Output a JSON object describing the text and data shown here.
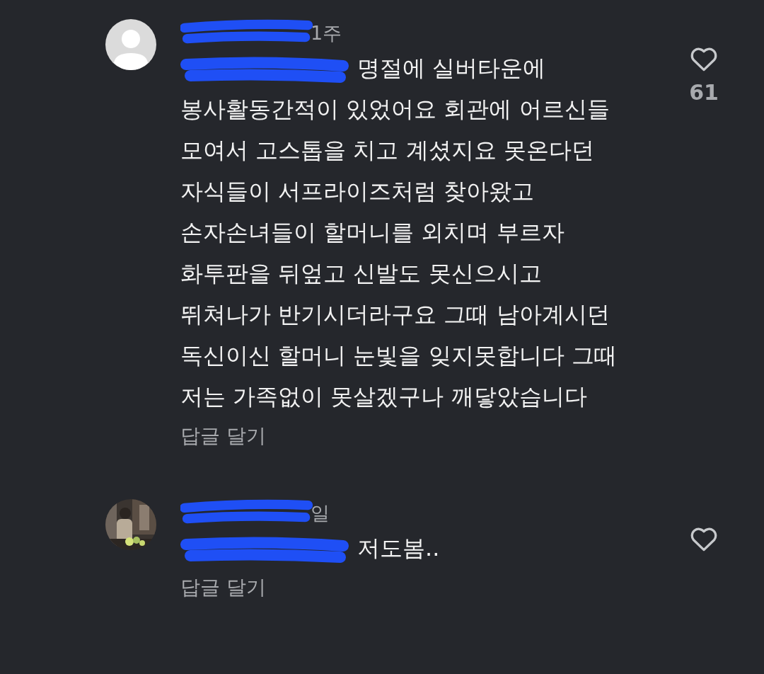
{
  "comments": [
    {
      "kind": "default",
      "time": "1주",
      "lines": [
        "명절에 실버타운에",
        "봉사활동간적이 있었어요 회관에 어르신들",
        "모여서 고스톱을 치고 계셨지요 못온다던",
        "자식들이 서프라이즈처럼 찾아왔고",
        "손자손녀들이 할머니를 외치며 부르자",
        "화투판을 뒤엎고 신발도 못신으시고",
        "뛰쳐나가 반기시더라구요 그때 남아계시던",
        "독신이신 할머니 눈빛을 잊지못합니다 그때",
        "저는 가족없이 못살겠구나 깨닿았습니다"
      ],
      "reply": "답글 달기",
      "liked": false,
      "likes": "61"
    },
    {
      "time": "일",
      "lines": [
        "저도봄.."
      ],
      "reply": "답글 달기",
      "liked": false
    }
  ]
}
